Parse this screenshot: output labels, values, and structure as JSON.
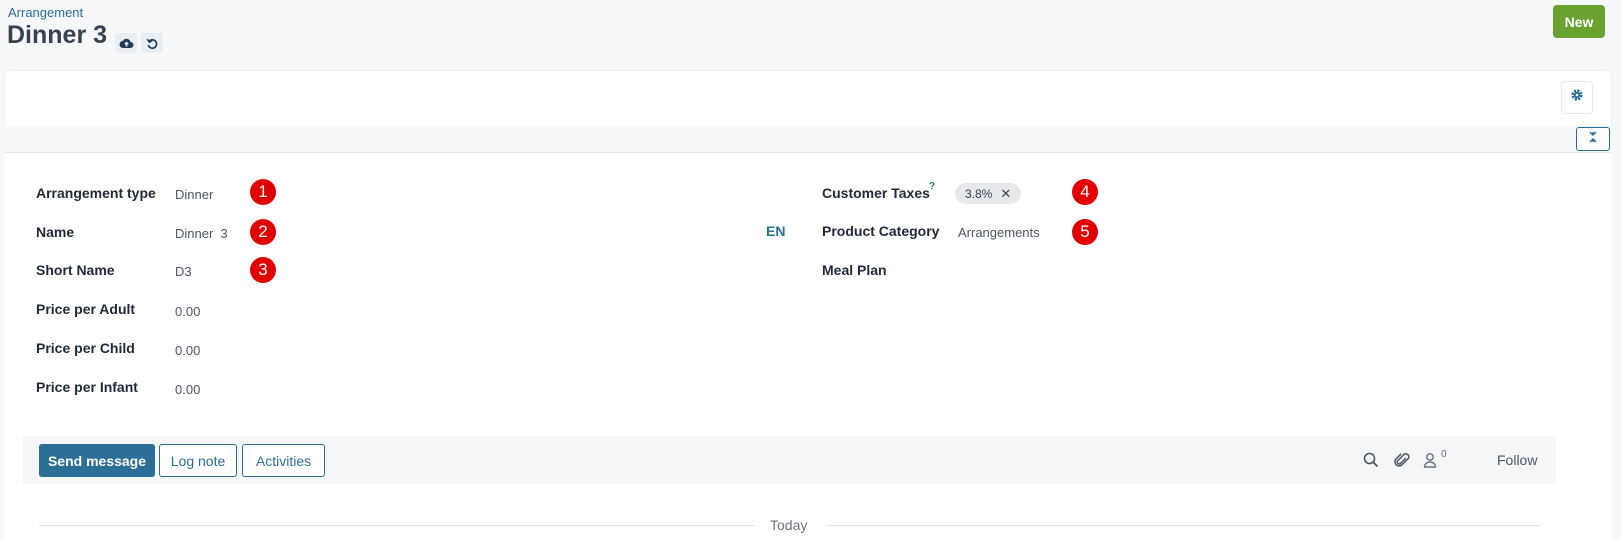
{
  "header": {
    "breadcrumb": "Arrangement",
    "title": "Dinner 3",
    "new_label": "New"
  },
  "icons": {
    "save": "cloud-upload-icon",
    "discard": "undo-icon",
    "settings": "gear-icon",
    "collapse": "collapse-icon",
    "search": "search-icon",
    "attach": "paperclip-icon",
    "followers": "user-icon"
  },
  "form": {
    "left": [
      {
        "label": "Arrangement type",
        "value": "Dinner",
        "marker": "1"
      },
      {
        "label": "Name",
        "value": "Dinner  3",
        "marker": "2"
      },
      {
        "label": "Short Name",
        "value": "D3",
        "marker": "3"
      },
      {
        "label": "Price per Adult",
        "value": "0.00"
      },
      {
        "label": "Price per Child",
        "value": "0.00"
      },
      {
        "label": "Price per Infant",
        "value": "0.00"
      }
    ],
    "lang": "EN",
    "right": [
      {
        "label": "Customer Taxes",
        "tooltip": "?",
        "tag": "3.8%",
        "tag_remove": "✕",
        "marker": "4"
      },
      {
        "label": "Product Category",
        "value": "Arrangements",
        "marker": "5"
      },
      {
        "label": "Meal Plan",
        "value": ""
      }
    ]
  },
  "chatter": {
    "send_message": "Send message",
    "log_note": "Log note",
    "activities": "Activities",
    "follower_count": "0",
    "follow": "Follow",
    "today": "Today"
  },
  "colors": {
    "accent": "#2b6e96",
    "new_button": "#6aa230",
    "marker": "#e00000"
  }
}
